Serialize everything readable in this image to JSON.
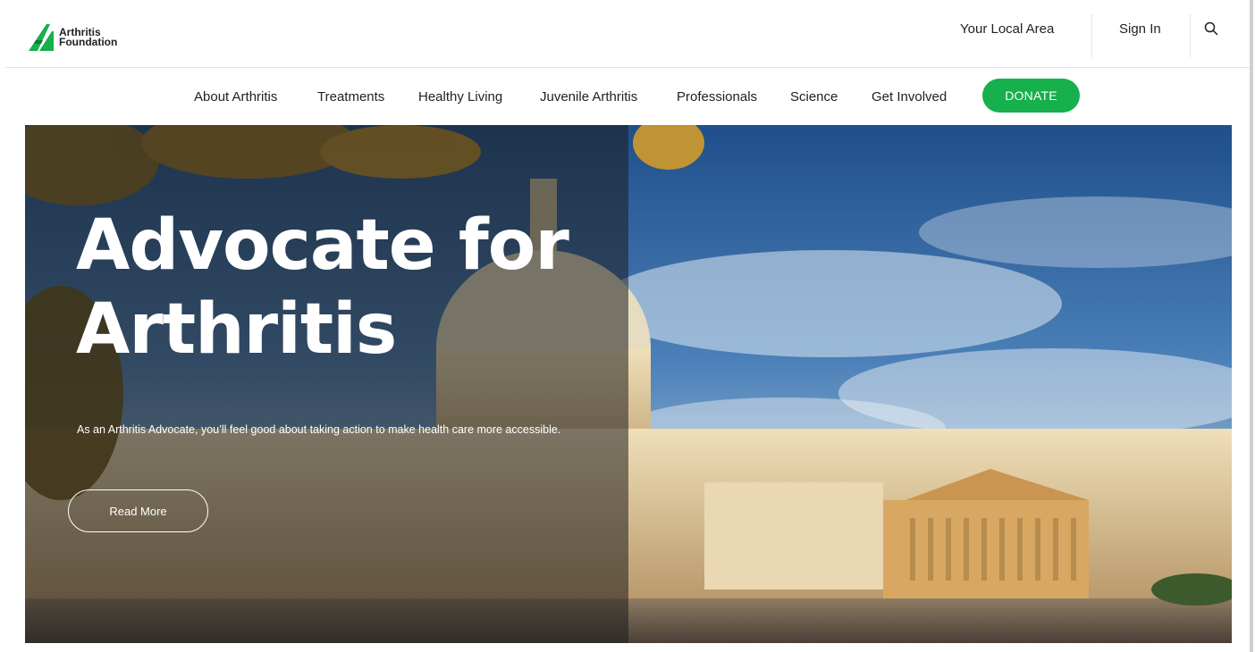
{
  "brand": {
    "line1": "Arthritis",
    "line2": "Foundation",
    "accent": "#16b04c"
  },
  "utility": {
    "local_area": "Your Local Area",
    "sign_in": "Sign In",
    "search_icon": "search-icon"
  },
  "nav": {
    "items": [
      "About Arthritis",
      "Treatments",
      "Healthy Living",
      "Juvenile Arthritis",
      "Professionals",
      "Science",
      "Get Involved"
    ],
    "donate": "DONATE"
  },
  "hero": {
    "title": "Advocate for Arthritis",
    "subtitle": "As an Arthritis Advocate, you’ll feel good about taking action to make health care more accessible.",
    "button": "Read More"
  }
}
